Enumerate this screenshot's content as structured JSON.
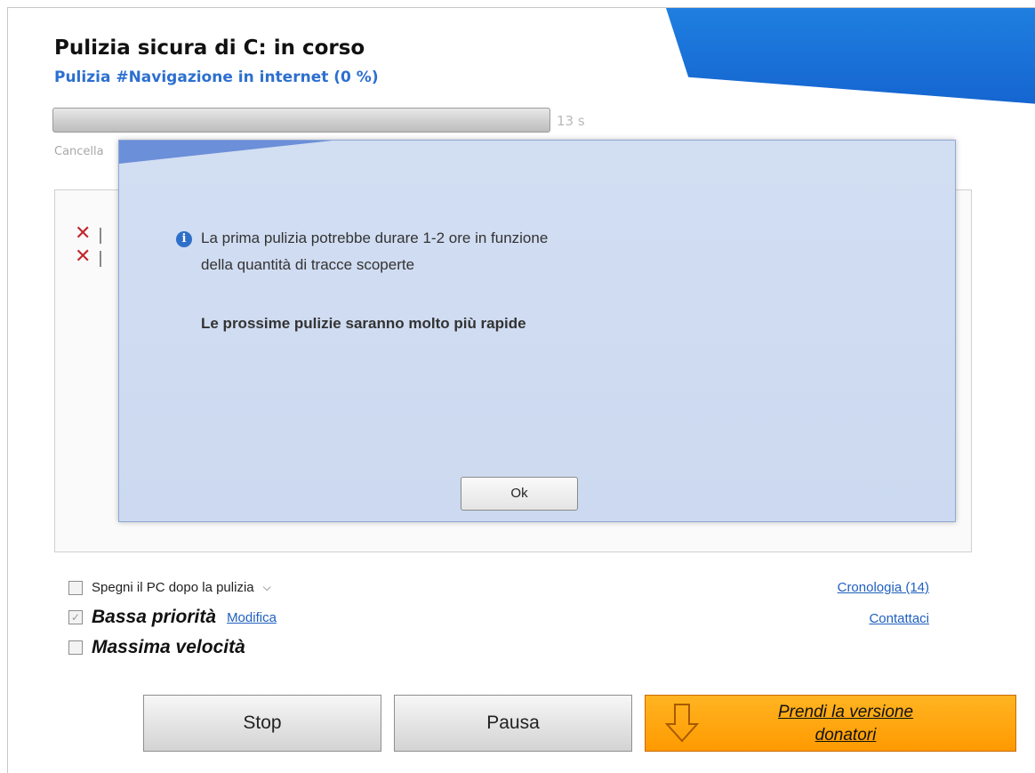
{
  "header": {
    "title": "Pulizia sicura di C: in corso",
    "subtitle": "Pulizia #Navigazione in internet (0 %)"
  },
  "progress": {
    "value_percent": 0,
    "timer": "13 s",
    "status_text": "Cancella"
  },
  "dialog": {
    "line1": "La prima pulizia potrebbe durare  1-2 ore in funzione",
    "line2": "della quantità di tracce scoperte",
    "bold_line": "Le prossime pulizie saranno molto più rapide",
    "ok_label": "Ok"
  },
  "options": {
    "shutdown_label": "Spegni il PC dopo la pulizia",
    "shutdown_checked": false,
    "low_priority_label": "Bassa priorità",
    "low_priority_checked": true,
    "modify_label": "Modifica",
    "max_speed_label": "Massima velocità",
    "max_speed_checked": false
  },
  "links": {
    "history": "Cronologia (14)",
    "contact": "Contattaci"
  },
  "buttons": {
    "stop": "Stop",
    "pause": "Pausa",
    "donate_line1": "Prendi la versione",
    "donate_line2": "donatori"
  },
  "colors": {
    "accent_blue": "#1f7fe0",
    "link_blue": "#1f5fbf",
    "donate_orange": "#ff9a00"
  }
}
